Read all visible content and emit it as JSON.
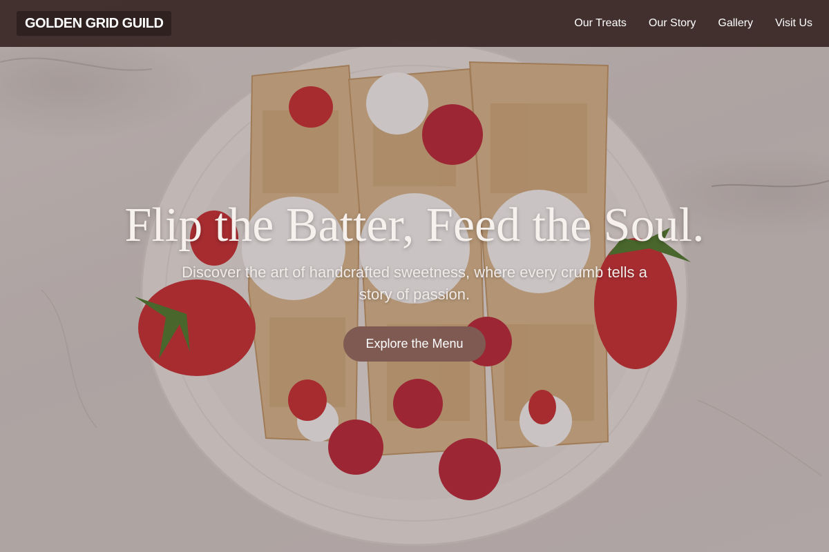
{
  "nav": {
    "logo": "GOLDEN GRID GUILD",
    "links": [
      "Our Treats",
      "Our Story",
      "Gallery",
      "Visit Us"
    ]
  },
  "hero": {
    "title": "Flip the Batter, Feed the Soul.",
    "subtitle": "Discover the art of handcrafted sweetness, where every crumb tells a story of passion.",
    "cta_label": "Explore the Menu"
  },
  "colors": {
    "navbar_bg": "#3e2c2a",
    "logo_bg": "#2e2120",
    "cta_bg": "#7e5a52",
    "text_light": "#f7f1ee"
  },
  "images": {
    "hero_background": "crepes-with-strawberries-raspberries-and-whipped-cream-on-white-plate"
  }
}
